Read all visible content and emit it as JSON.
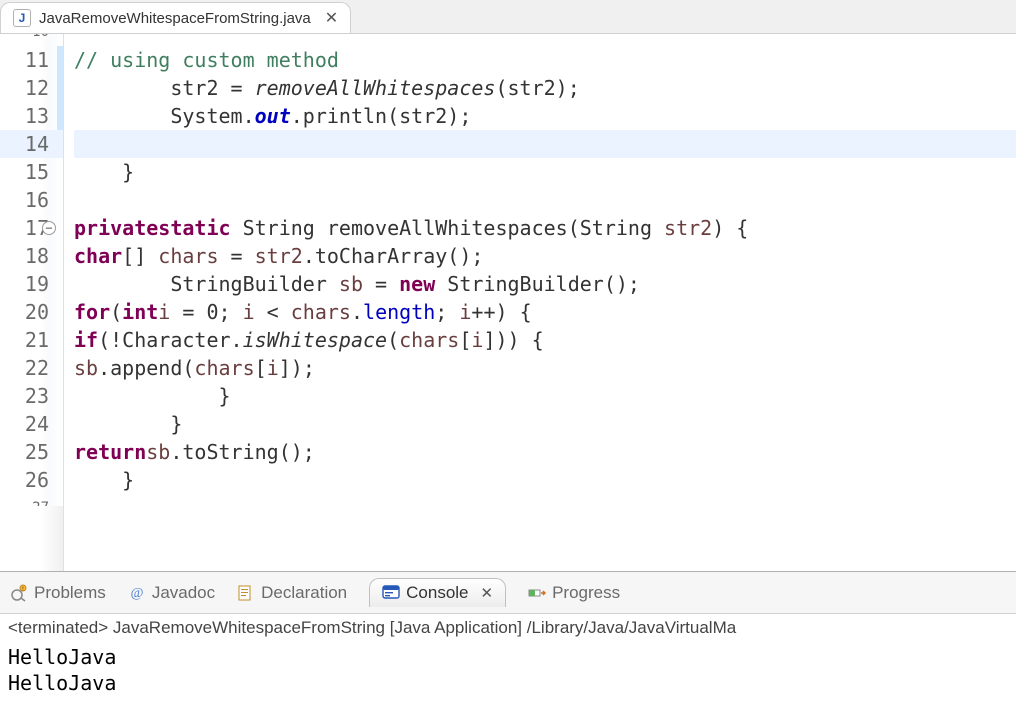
{
  "editor": {
    "tab": {
      "filename": "JavaRemoveWhitespaceFromString.java"
    },
    "lines": [
      {
        "n": 10,
        "partial": true,
        "html": ""
      },
      {
        "n": 11,
        "diffband": true,
        "html": "        <span class='tok-cm'>// using custom method</span>"
      },
      {
        "n": 12,
        "diffband": true,
        "html": "        str2 = <span class='tok-call-i'>removeAllWhitespaces</span>(str2);"
      },
      {
        "n": 13,
        "diffband": true,
        "html": "        System.<span class='tok-fld'>out</span>.println(str2);"
      },
      {
        "n": 14,
        "current": true,
        "html": ""
      },
      {
        "n": 15,
        "html": "    }"
      },
      {
        "n": 16,
        "html": ""
      },
      {
        "n": 17,
        "fold": true,
        "html": "    <span class='tok-kw'>private</span> <span class='tok-kw'>static</span> String removeAllWhitespaces(String <span class='tok-var2'>str2</span>) {"
      },
      {
        "n": 18,
        "html": "        <span class='tok-kw'>char</span>[] <span class='tok-var2'>chars</span> = <span class='tok-var2'>str2</span>.toCharArray();"
      },
      {
        "n": 19,
        "html": "        StringBuilder <span class='tok-var2'>sb</span> = <span class='tok-kw'>new</span> StringBuilder();"
      },
      {
        "n": 20,
        "html": "        <span class='tok-kw'>for</span>(<span class='tok-kw'>int</span> <span class='tok-var2'>i</span> = 0; <span class='tok-var2'>i</span> &lt; <span class='tok-var2'>chars</span>.<span class='tok-fldname'>length</span>; <span class='tok-var2'>i</span>++) {"
      },
      {
        "n": 21,
        "html": "            <span class='tok-kw'>if</span>(!Character.<span class='tok-call-i'>isWhitespace</span>(<span class='tok-var2'>chars</span>[<span class='tok-var2'>i</span>])) {"
      },
      {
        "n": 22,
        "html": "                <span class='tok-var2'>sb</span>.append(<span class='tok-var2'>chars</span>[<span class='tok-var2'>i</span>]);"
      },
      {
        "n": 23,
        "html": "            }"
      },
      {
        "n": 24,
        "html": "        }"
      },
      {
        "n": 25,
        "html": "        <span class='tok-kw'>return</span> <span class='tok-var2'>sb</span>.toString();"
      },
      {
        "n": 26,
        "html": "    }"
      },
      {
        "n": 27,
        "partial": true,
        "html": ""
      }
    ]
  },
  "views": {
    "tabs": {
      "problems": "Problems",
      "javadoc": "Javadoc",
      "declaration": "Declaration",
      "console": "Console",
      "progress": "Progress"
    },
    "console": {
      "status": "<terminated> JavaRemoveWhitespaceFromString [Java Application] /Library/Java/JavaVirtualMa",
      "output": "HelloJava\nHelloJava"
    }
  }
}
